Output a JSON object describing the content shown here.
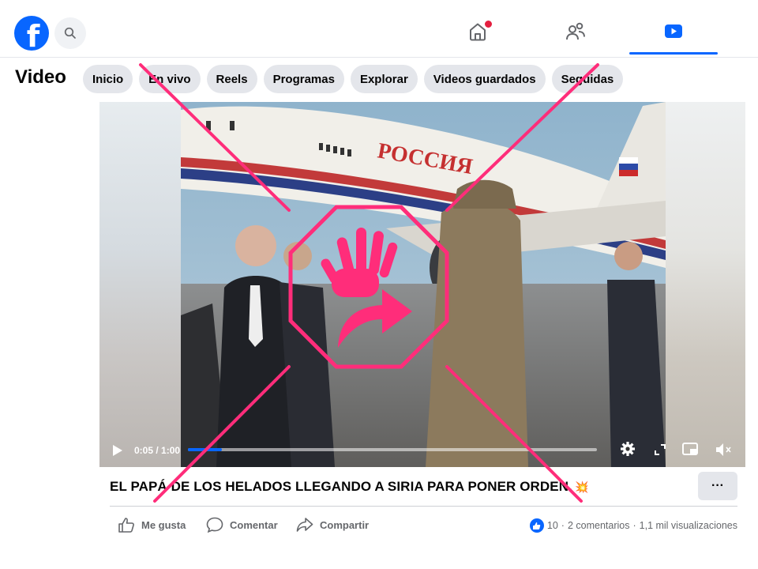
{
  "header": {
    "logo_icon": "facebook-logo-icon",
    "search_icon": "search-icon",
    "nav": [
      {
        "name": "home-icon",
        "notification": true
      },
      {
        "name": "friends-icon",
        "notification": false
      },
      {
        "name": "video-icon",
        "active": true
      }
    ],
    "brand_color": "#0866ff"
  },
  "section": {
    "title": "Video",
    "chips": [
      "Inicio",
      "En vivo",
      "Reels",
      "Programas",
      "Explorar",
      "Videos guardados",
      "Seguidas"
    ]
  },
  "player": {
    "time": "0:05 / 1:00",
    "progress": 0.083,
    "plane_text": "РОССИЯ",
    "controls": [
      "play-icon",
      "settings-icon",
      "fullscreen-icon",
      "miniplayer-icon",
      "volume-muted-icon"
    ]
  },
  "post": {
    "title": "EL PAPÁ DE LOS HELADOS LLEGANDO A SIRIA PARA PONER ORDEN.",
    "emoji": "💥",
    "more_label": "···"
  },
  "actions": {
    "like": "Me gusta",
    "comment": "Comentar",
    "share": "Compartir"
  },
  "stats": {
    "likes": "10",
    "separator": "·",
    "comments": "2 comentarios",
    "views": "1,1 mil visualizaciones"
  },
  "overlay": {
    "type": "stop-hand-share-icon",
    "color": "#ff2d7a"
  }
}
